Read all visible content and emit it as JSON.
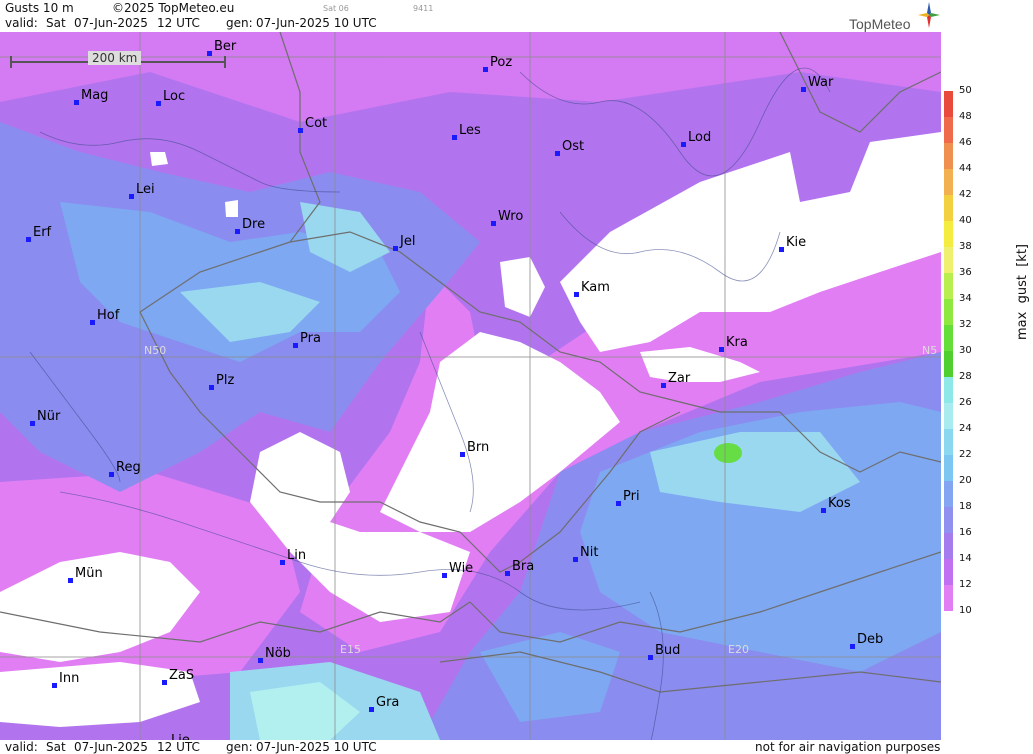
{
  "header": {
    "title": "Gusts 10 m",
    "copyright": "©2025 TopMeteo.eu",
    "valid_label": "valid:",
    "valid_day": "Sat",
    "valid_date": "07-Jun-2025",
    "valid_time": "12 UTC",
    "gen_label": "gen:",
    "gen_date": "07-Jun-2025 10 UTC",
    "small_day": "Sat 06",
    "small_code": "9411",
    "brand": "TopMeteo"
  },
  "scale": {
    "label": "200 km"
  },
  "grid_labels": {
    "n50_left": "N50",
    "n50_right": "N5",
    "e15": "E15",
    "e20": "E20"
  },
  "cities": [
    {
      "name": "Ber"
    },
    {
      "name": "Poz"
    },
    {
      "name": "War"
    },
    {
      "name": "Mag"
    },
    {
      "name": "Loc"
    },
    {
      "name": "Cot"
    },
    {
      "name": "Les"
    },
    {
      "name": "Ost"
    },
    {
      "name": "Lod"
    },
    {
      "name": "Lei"
    },
    {
      "name": "Dre"
    },
    {
      "name": "Wro"
    },
    {
      "name": "Erf"
    },
    {
      "name": "Jel"
    },
    {
      "name": "Kie"
    },
    {
      "name": "Kam"
    },
    {
      "name": "Hof"
    },
    {
      "name": "Pra"
    },
    {
      "name": "Kra"
    },
    {
      "name": "Plz"
    },
    {
      "name": "Zar"
    },
    {
      "name": "Nür"
    },
    {
      "name": "Brn"
    },
    {
      "name": "Reg"
    },
    {
      "name": "Pri"
    },
    {
      "name": "Kos"
    },
    {
      "name": "Lin"
    },
    {
      "name": "Nit"
    },
    {
      "name": "Mün"
    },
    {
      "name": "Wie"
    },
    {
      "name": "Bra"
    },
    {
      "name": "Deb"
    },
    {
      "name": "Nöb"
    },
    {
      "name": "Bud"
    },
    {
      "name": "Inn"
    },
    {
      "name": "ZaS"
    },
    {
      "name": "Gra"
    },
    {
      "name": "Lie"
    }
  ],
  "legend": {
    "title": "max  gust  [kt]",
    "ticks": [
      "50",
      "48",
      "46",
      "44",
      "42",
      "40",
      "38",
      "36",
      "34",
      "32",
      "30",
      "28",
      "26",
      "24",
      "22",
      "20",
      "18",
      "16",
      "14",
      "12",
      "10"
    ],
    "colors": {
      "50": "#e84a3c",
      "48": "#ee6a4a",
      "46": "#f09050",
      "44": "#f2b050",
      "42": "#f2d040",
      "40": "#f4ec40",
      "38": "#f0f070",
      "36": "#b8ee50",
      "34": "#8ee840",
      "32": "#66de3a",
      "30": "#50d030",
      "28": "#8ee8e8",
      "26": "#a8ecf0",
      "24": "#8ad8f0",
      "22": "#7cc6f2",
      "20": "#84a6f2",
      "18": "#9090f0",
      "16": "#a47cee",
      "14": "#c070f0",
      "12": "#e27ef4"
    }
  },
  "footer": {
    "valid_label": "valid:",
    "valid_day": "Sat",
    "valid_date": "07-Jun-2025",
    "valid_time": "12 UTC",
    "gen_label": "gen:",
    "gen_date": "07-Jun-2025 10 UTC",
    "disclaimer": "not for air navigation purposes"
  },
  "map_colors": {
    "bg": "#ffffff",
    "light_violet": "#e27ef4",
    "violet": "#b274ee",
    "blue_violet": "#8a8cf0",
    "blue": "#7ea8f2",
    "cyan": "#9ad8f0",
    "light_cyan": "#b2f0f0",
    "green": "#66dd44"
  }
}
